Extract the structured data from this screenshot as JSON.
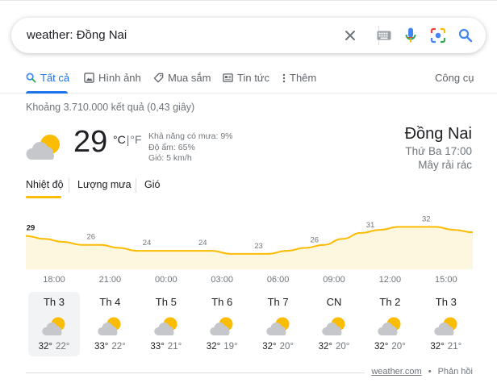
{
  "search": {
    "query": "weather: Đồng Nai"
  },
  "tabs": [
    {
      "label": "Tất cả"
    },
    {
      "label": "Hình ảnh"
    },
    {
      "label": "Mua sắm"
    },
    {
      "label": "Tin tức"
    },
    {
      "label": "Thêm"
    }
  ],
  "tools_label": "Công cụ",
  "result_stats": "Khoảng 3.710.000 kết quả (0,43 giây)",
  "current": {
    "temp": "29",
    "unit_c": "°C",
    "unit_sep": "|",
    "unit_f": "°F",
    "precip": "Khả năng có mưa: 9%",
    "humidity": "Độ ẩm: 65%",
    "wind": "Gió: 5 km/h",
    "location": "Đồng Nai",
    "time": "Thứ Ba 17:00",
    "condition": "Mây rải rác"
  },
  "weather_tabs": [
    {
      "label": "Nhiệt độ"
    },
    {
      "label": "Lượng mưa"
    },
    {
      "label": "Gió"
    }
  ],
  "chart_data": {
    "type": "area",
    "x": [
      "17:00",
      "18:00",
      "19:00",
      "20:00",
      "21:00",
      "22:00",
      "23:00",
      "00:00",
      "01:00",
      "02:00",
      "03:00",
      "04:00",
      "05:00",
      "06:00",
      "07:00",
      "08:00",
      "09:00",
      "10:00",
      "11:00",
      "12:00",
      "13:00",
      "14:00",
      "15:00",
      "16:00"
    ],
    "values": [
      29,
      28,
      27,
      26,
      26,
      25,
      24,
      24,
      24,
      24,
      24,
      23,
      23,
      23,
      24,
      25,
      26,
      28,
      30,
      31,
      32,
      32,
      32,
      31
    ],
    "labels": [
      {
        "index": 0,
        "text": "29"
      },
      {
        "index": 3,
        "text": "26"
      },
      {
        "index": 6,
        "text": "24"
      },
      {
        "index": 9,
        "text": "24"
      },
      {
        "index": 12,
        "text": "23"
      },
      {
        "index": 15,
        "text": "26"
      },
      {
        "index": 18,
        "text": "31"
      },
      {
        "index": 21,
        "text": "32"
      }
    ],
    "ylim": [
      20,
      34
    ],
    "line_color": "#fbbc04",
    "fill_color": "#fef7e0"
  },
  "hours": [
    "18:00",
    "21:00",
    "00:00",
    "03:00",
    "06:00",
    "09:00",
    "12:00",
    "15:00"
  ],
  "days": [
    {
      "name": "Th 3",
      "hi": "32°",
      "lo": "22°",
      "selected": true
    },
    {
      "name": "Th 4",
      "hi": "33°",
      "lo": "22°"
    },
    {
      "name": "Th 5",
      "hi": "33°",
      "lo": "21°"
    },
    {
      "name": "Th 6",
      "hi": "32°",
      "lo": "19°"
    },
    {
      "name": "Th 7",
      "hi": "32°",
      "lo": "20°"
    },
    {
      "name": "CN",
      "hi": "32°",
      "lo": "20°"
    },
    {
      "name": "Th 2",
      "hi": "32°",
      "lo": "20°"
    },
    {
      "name": "Th 3",
      "hi": "32°",
      "lo": "21°"
    }
  ],
  "footer": {
    "source": "weather.com",
    "dot": "•",
    "feedback": "Phản hồi"
  },
  "colors": {
    "accent": "#1a73e8",
    "sun": "#fbbc04",
    "cloud": "#c5c7ca"
  }
}
